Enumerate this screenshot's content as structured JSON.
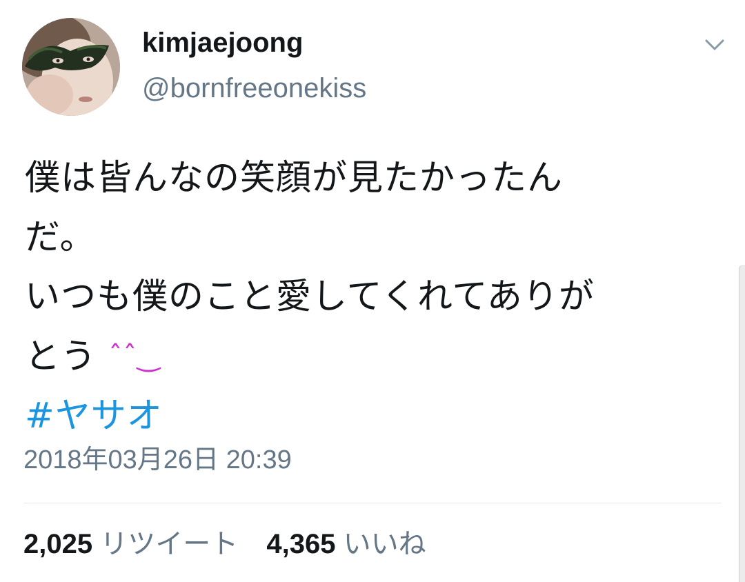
{
  "user": {
    "display_name": "kimjaejoong",
    "handle": "@bornfreeonekiss",
    "avatar_desc": "avatar"
  },
  "tweet": {
    "lines": [
      "僕は皆んなの笑顔が見たかったん",
      "だ。",
      "いつも僕のこと愛してくれてありが",
      "とう"
    ],
    "emoji": "ˆˆ‿",
    "hashtag": "#ヤサオ",
    "timestamp": "2018年03月26日 20:39"
  },
  "stats": {
    "retweets_count": "2,025",
    "retweets_label": "リツイート",
    "likes_count": "4,365",
    "likes_label": "いいね"
  },
  "colors": {
    "text": "#14171a",
    "secondary": "#657786",
    "link": "#1b95e0",
    "emoji": "#cc33cc",
    "divider": "#e1e8ed"
  },
  "icons": {
    "menu": "chevron-down-icon"
  }
}
